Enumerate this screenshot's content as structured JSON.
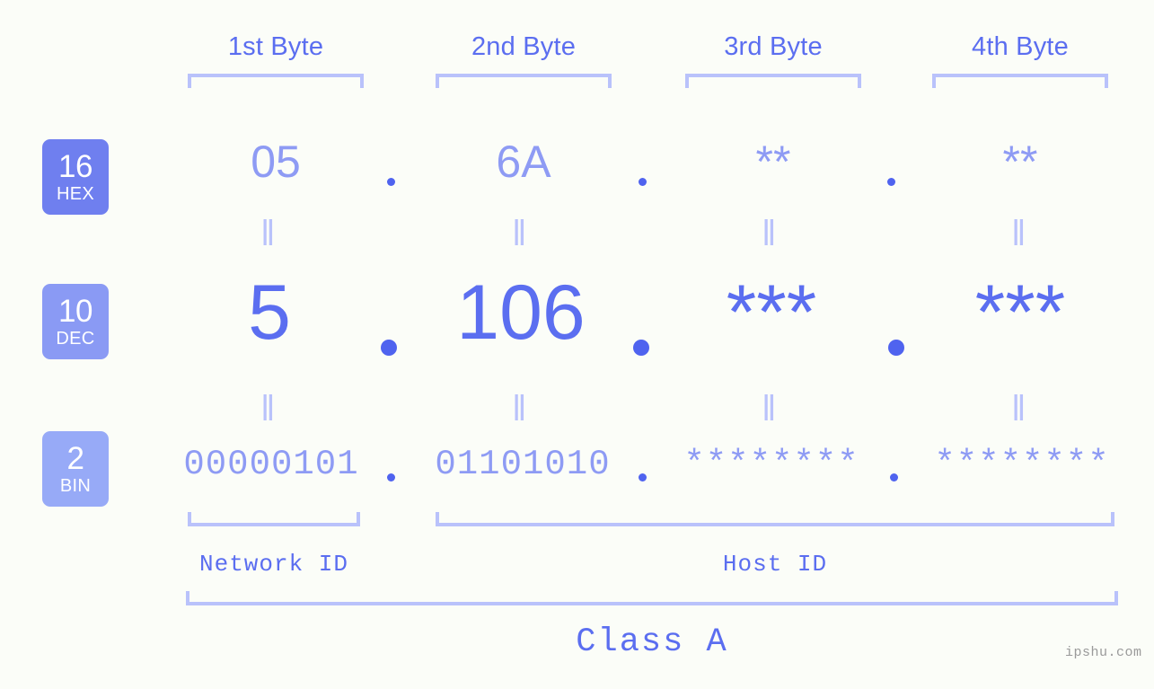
{
  "page": {
    "background_color": "#fbfdf8",
    "accent_strong": "#5b6ef0",
    "accent_light": "#8e9bf4",
    "accent_pale": "#b9c2fb",
    "watermark": "ipshu.com"
  },
  "byte_headers": [
    {
      "label": "1st Byte"
    },
    {
      "label": "2nd Byte"
    },
    {
      "label": "3rd Byte"
    },
    {
      "label": "4th Byte"
    }
  ],
  "rows": [
    {
      "badge_number": "16",
      "badge_name": "HEX",
      "badge_color": "#6f7fef",
      "values": [
        "05",
        "6A",
        "**",
        "**"
      ]
    },
    {
      "badge_number": "10",
      "badge_name": "DEC",
      "badge_color": "#8a9af4",
      "values": [
        "5",
        "106",
        "***",
        "***"
      ]
    },
    {
      "badge_number": "2",
      "badge_name": "BIN",
      "badge_color": "#97aaf7",
      "values": [
        "00000101",
        "01101010",
        "********",
        "********"
      ]
    }
  ],
  "separator": ".",
  "equality_mark": "‖",
  "segments": [
    {
      "label": "Network ID"
    },
    {
      "label": "Host ID"
    }
  ],
  "class_label": "Class A"
}
